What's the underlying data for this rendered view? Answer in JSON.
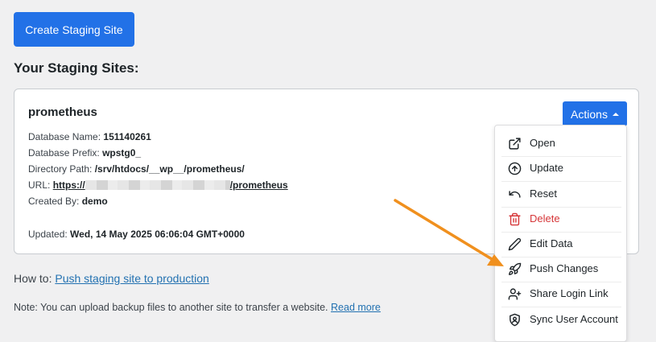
{
  "create_button_label": "Create Staging Site",
  "section_title": "Your Staging Sites:",
  "site": {
    "name": "prometheus",
    "fields": {
      "db_name_label": "Database Name:",
      "db_name_value": "151140261",
      "db_prefix_label": "Database Prefix:",
      "db_prefix_value": "wpstg0_",
      "dir_label": "Directory Path:",
      "dir_value": "/srv/htdocs/__wp__/prometheus/",
      "url_label": "URL:",
      "url_prefix": "https://",
      "url_suffix": "/prometheus",
      "created_label": "Created By:",
      "created_value": "demo",
      "updated_label": "Updated:",
      "updated_value": "Wed, 14 May 2025 06:06:04 GMT+0000"
    }
  },
  "actions_label": "Actions",
  "menu": [
    {
      "label": "Open",
      "icon": "external-link-icon"
    },
    {
      "label": "Update",
      "icon": "arrow-up-circle-icon"
    },
    {
      "label": "Reset",
      "icon": "undo-icon"
    },
    {
      "label": "Delete",
      "icon": "trash-icon"
    },
    {
      "label": "Edit Data",
      "icon": "pencil-icon"
    },
    {
      "label": "Push Changes",
      "icon": "rocket-icon"
    },
    {
      "label": "Share Login Link",
      "icon": "user-plus-icon"
    },
    {
      "label": "Sync User Account",
      "icon": "user-shield-icon"
    }
  ],
  "howto": {
    "prefix": "How to:",
    "link": "Push staging site to production"
  },
  "note": {
    "text": "Note: You can upload backup files to another site to transfer a website.",
    "link": "Read more"
  },
  "colors": {
    "primary": "#2271e7",
    "danger": "#d63638",
    "link": "#2271b1",
    "annotation_arrow": "#f0901e"
  }
}
